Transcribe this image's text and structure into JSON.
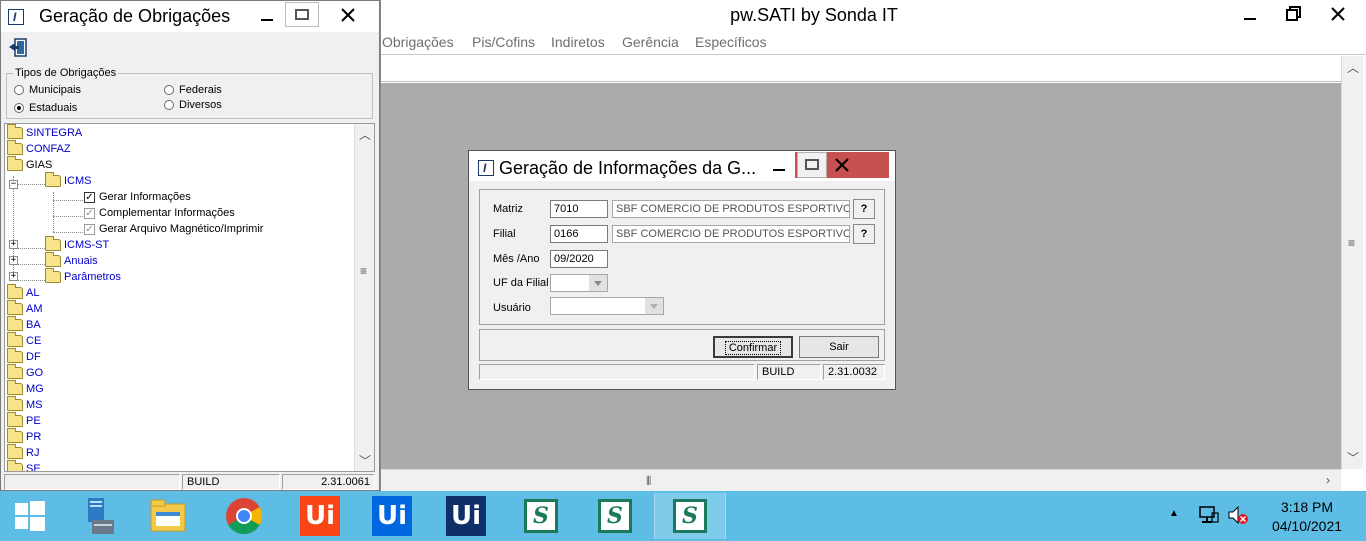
{
  "left_window": {
    "title": "Geração de Obrigações",
    "minimize_glyph": "—",
    "maximize_glyph": "▭",
    "close_glyph": "✕",
    "exit_icon": "exit-door-icon",
    "tipos_group": {
      "legend": "Tipos de Obrigações",
      "options": [
        {
          "label": "Municipais",
          "checked": false
        },
        {
          "label": "Federais",
          "checked": false
        },
        {
          "label": "Estaduais",
          "checked": true
        },
        {
          "label": "Diversos",
          "checked": false
        }
      ]
    },
    "tree": {
      "sintegra": "SINTEGRA",
      "confaz": "CONFAZ",
      "gias": "GIAS",
      "icms": "ICMS",
      "icms_children": [
        "Gerar Informações",
        "Complementar Informações",
        "Gerar Arquivo Magnético/Imprimir"
      ],
      "icms_st": "ICMS-ST",
      "anuais": "Anuais",
      "parametros": "Parâmetros",
      "states": [
        "AL",
        "AM",
        "BA",
        "CE",
        "DF",
        "GO",
        "MG",
        "MS",
        "PE",
        "PR",
        "RJ",
        "SE"
      ]
    },
    "status": {
      "build_label": "BUILD",
      "build_value": "2.31.0061"
    }
  },
  "main_window": {
    "title": "pw.SATI by Sonda IT",
    "menu": [
      "Obrigações",
      "Pis/Cofins",
      "Indiretos",
      "Gerência",
      "Específicos"
    ]
  },
  "dialog": {
    "title": "Geração de Informações da G...",
    "matriz": {
      "label": "Matriz",
      "code": "7010",
      "name": "SBF COMERCIO DE PRODUTOS ESPORTIVOS"
    },
    "filial": {
      "label": "Filial",
      "code": "0166",
      "name": "SBF COMERCIO DE PRODUTOS ESPORTIVOS"
    },
    "mes_ano": {
      "label": "Mês /Ano",
      "value": "09/2020"
    },
    "uf_filial": {
      "label": "UF da Filial",
      "value": ""
    },
    "usuario": {
      "label": "Usuário",
      "value": ""
    },
    "lookup_label": "?",
    "confirm_label": "Confirmar",
    "exit_label": "Sair",
    "status": {
      "build_label": "BUILD",
      "build_value": "2.31.0032"
    }
  },
  "taskbar": {
    "apps": [
      {
        "name": "windows-start-icon"
      },
      {
        "name": "server-manager-icon"
      },
      {
        "name": "file-explorer-icon"
      },
      {
        "name": "chrome-icon"
      },
      {
        "name": "uipath-studio-icon",
        "text": "Ui",
        "color": "#fa4616"
      },
      {
        "name": "uipath-robot-icon",
        "text": "Ui",
        "color": "#0067df"
      },
      {
        "name": "uipath-assistant-icon",
        "text": "Ui",
        "color": "#0f2f69"
      },
      {
        "name": "sati-icon-1",
        "text": "S"
      },
      {
        "name": "sati-icon-2",
        "text": "S"
      },
      {
        "name": "sati-icon-3",
        "text": "S"
      }
    ],
    "time": "3:18 PM",
    "date": "04/10/2021"
  }
}
